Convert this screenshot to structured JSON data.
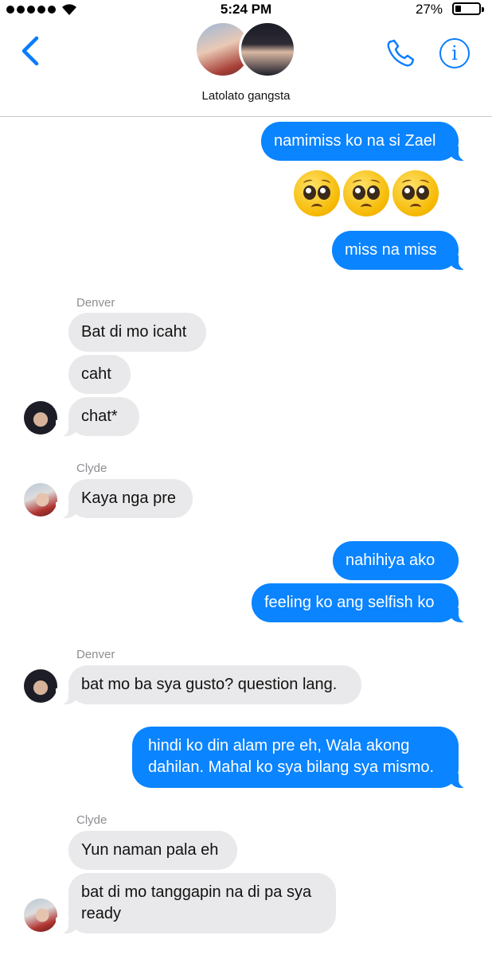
{
  "status_bar": {
    "time": "5:24 PM",
    "battery_percent": "27%"
  },
  "header": {
    "group_name": "Latolato gangsta",
    "info_glyph": "i"
  },
  "icons": {
    "back": "chevron-left-icon",
    "call": "phone-icon",
    "info": "info-icon"
  },
  "colors": {
    "accent": "#0a84ff",
    "received_bubble": "#e9e9eb"
  },
  "messages": [
    {
      "from": "me",
      "text": "namimiss ko na si Zael"
    },
    {
      "from": "me",
      "type": "emoji",
      "emoji": "pleading-face",
      "count": 3
    },
    {
      "from": "me",
      "text": "miss na miss"
    },
    {
      "from": "Denver",
      "sender_label": "Denver",
      "text": "Bat di mo icaht"
    },
    {
      "from": "Denver",
      "text": "caht"
    },
    {
      "from": "Denver",
      "text": "chat*"
    },
    {
      "from": "Clyde",
      "sender_label": "Clyde",
      "text": "Kaya nga pre"
    },
    {
      "from": "me",
      "text": "nahihiya ako"
    },
    {
      "from": "me",
      "text": "feeling ko ang selfish ko"
    },
    {
      "from": "Denver",
      "sender_label": "Denver",
      "text": "bat mo ba sya gusto? question lang."
    },
    {
      "from": "me",
      "lines": [
        "hindi ko din alam pre eh, Wala akong",
        "dahilan. Mahal ko sya bilang sya mismo."
      ]
    },
    {
      "from": "Clyde",
      "sender_label": "Clyde",
      "text": "Yun naman pala eh"
    },
    {
      "from": "Clyde",
      "lines": [
        "bat di mo tanggapin na di pa sya",
        "ready"
      ]
    }
  ]
}
